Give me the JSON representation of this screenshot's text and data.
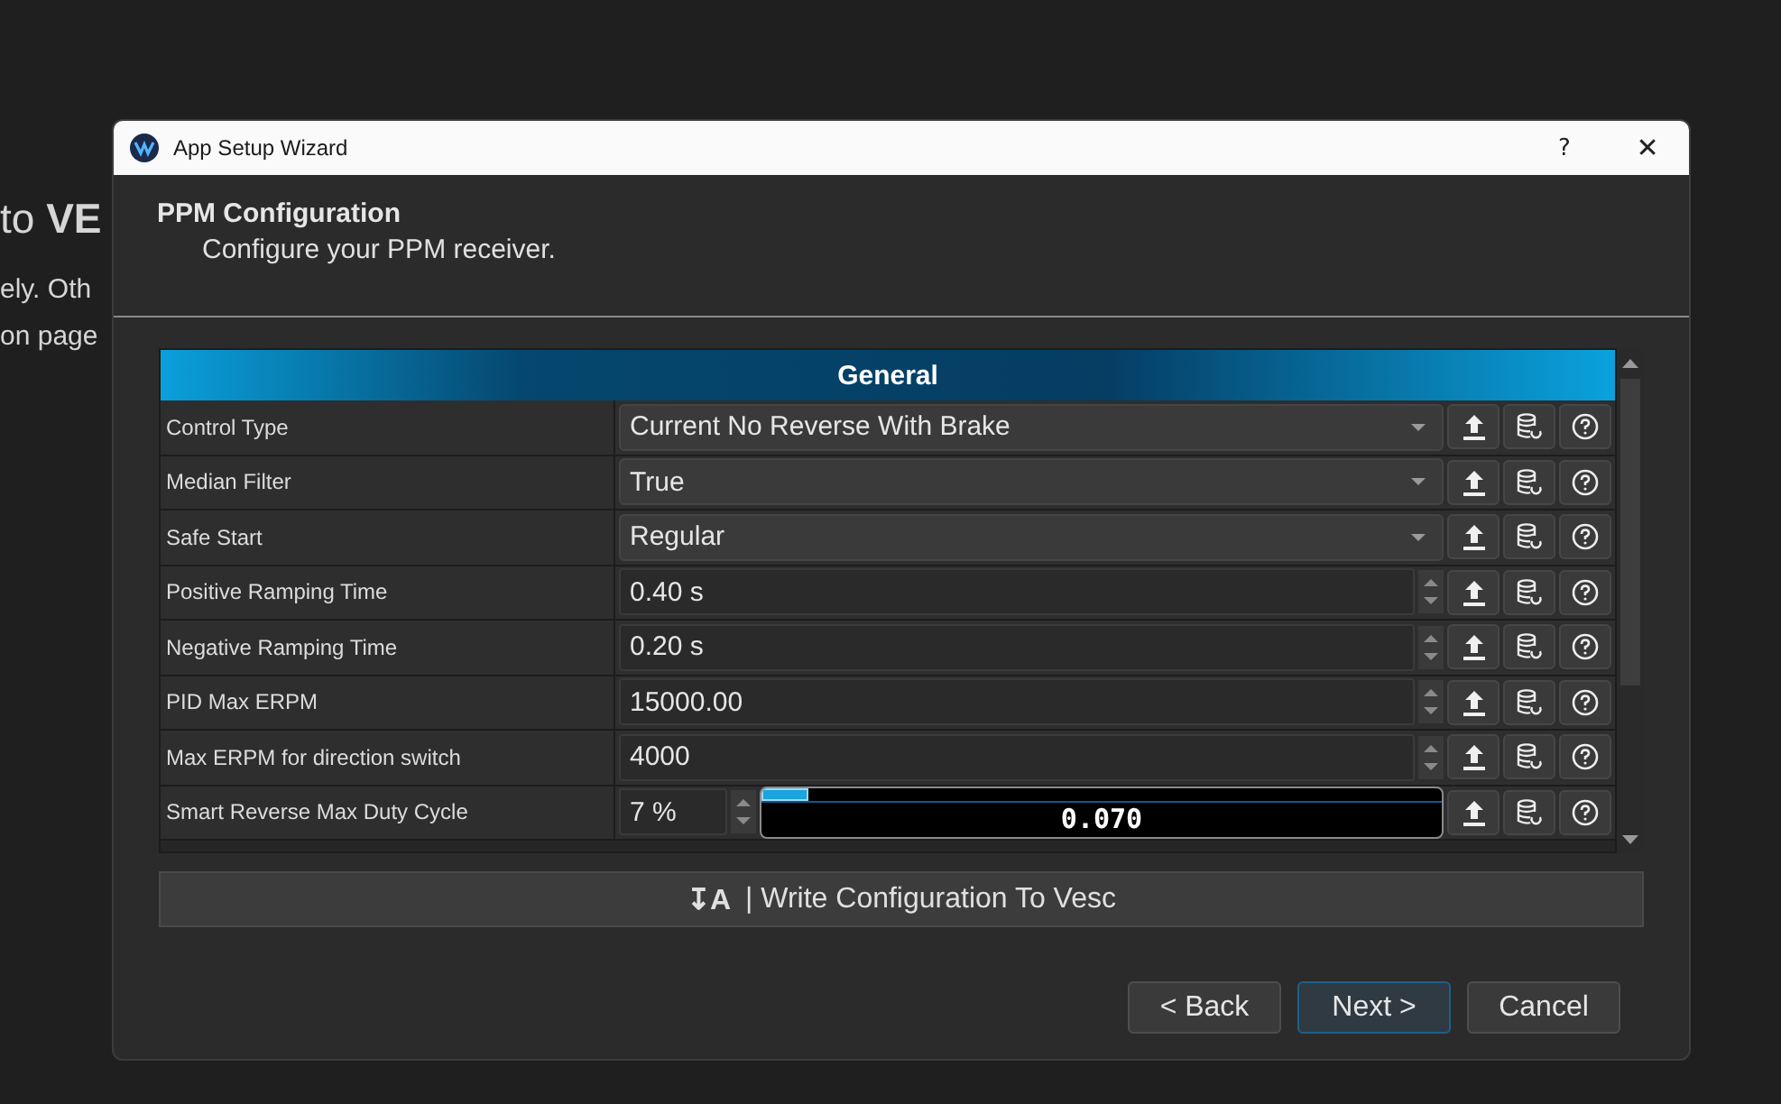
{
  "background_texts": [
    {
      "kind": "heading",
      "text": "to **VE**"
    },
    {
      "kind": "body",
      "text": "ely. Oth"
    },
    {
      "kind": "body",
      "text": "on page"
    }
  ],
  "window": {
    "title": "App Setup Wizard",
    "title_buttons": [
      {
        "kind": "help",
        "label": "?"
      },
      {
        "kind": "close",
        "label": "✕"
      }
    ]
  },
  "header": {
    "title": "PPM Configuration",
    "subtitle": "Configure your PPM receiver."
  },
  "group": {
    "title": "General"
  },
  "rows": [
    {
      "label": "Control Type",
      "kind": "combo",
      "value": "Current No Reverse With Brake"
    },
    {
      "label": "Median Filter",
      "kind": "combo",
      "value": "True"
    },
    {
      "label": "Safe Start",
      "kind": "combo",
      "value": "Regular"
    },
    {
      "label": "Positive Ramping Time",
      "kind": "spin",
      "value": "0.40 s"
    },
    {
      "label": "Negative Ramping Time",
      "kind": "spin",
      "value": "0.20 s"
    },
    {
      "label": "PID Max ERPM",
      "kind": "spin",
      "value": "15000.00"
    },
    {
      "label": "Max ERPM for direction switch",
      "kind": "spin",
      "value": "4000"
    },
    {
      "label": "Smart Reverse Max Duty Cycle",
      "kind": "slider",
      "value": "7 %",
      "level": 0.07,
      "reading": "0.070"
    }
  ],
  "write_button": {
    "icon_text": "↧A",
    "label": "| Write Configuration To Vesc"
  },
  "footer_buttons": [
    {
      "label": "< Back",
      "default": false
    },
    {
      "label": "Next >",
      "default": true
    },
    {
      "label": "Cancel",
      "default": false
    }
  ]
}
